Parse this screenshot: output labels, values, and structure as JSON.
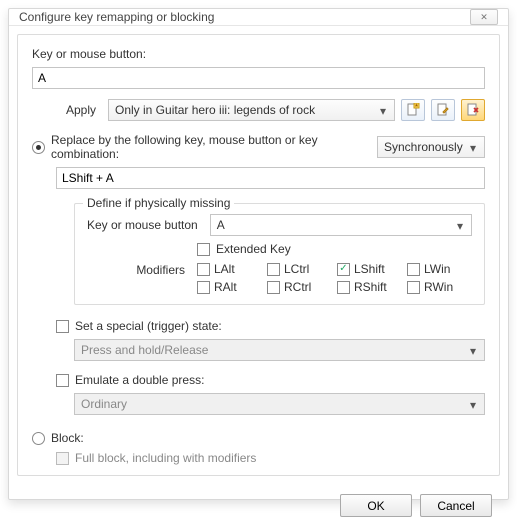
{
  "title": "Configure key remapping or blocking",
  "keyLabel": "Key or mouse button:",
  "keyValue": "A",
  "applyLabel": "Apply",
  "applyValue": "Only in Guitar hero iii: legends of rock",
  "replace": {
    "label": "Replace by the following key, mouse button or key combination:",
    "syncLabel": "Synchronously",
    "comboValue": "LShift + A",
    "group": {
      "legend": "Define if physically missing",
      "keyLabel": "Key or mouse button",
      "keyValue": "A",
      "extendedLabel": "Extended Key",
      "modifiersLabel": "Modifiers",
      "mods": {
        "LAlt": "LAlt",
        "LCtrl": "LCtrl",
        "LShift": "LShift",
        "LWin": "LWin",
        "RAlt": "RAlt",
        "RCtrl": "RCtrl",
        "RShift": "RShift",
        "RWin": "RWin"
      }
    }
  },
  "trigger": {
    "label": "Set a special (trigger) state:",
    "value": "Press and hold/Release"
  },
  "double": {
    "label": "Emulate a double press:",
    "value": "Ordinary"
  },
  "block": {
    "label": "Block:",
    "fullLabel": "Full block, including with modifiers"
  },
  "buttons": {
    "ok": "OK",
    "cancel": "Cancel"
  }
}
